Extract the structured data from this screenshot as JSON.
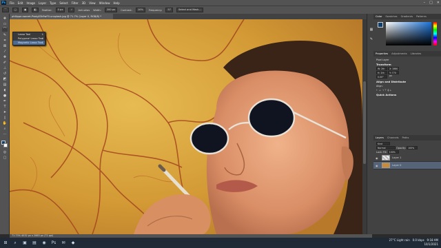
{
  "menubar": {
    "logo": "Ps",
    "items": [
      "File",
      "Edit",
      "Image",
      "Layer",
      "Type",
      "Select",
      "Filter",
      "3D",
      "View",
      "Window",
      "Help"
    ]
  },
  "window_controls": [
    "–",
    "□",
    "✕"
  ],
  "options": {
    "feather_label": "Feather:",
    "feather_value": "0 px",
    "antialias_label": "Anti-alias",
    "width_label": "Width:",
    "width_value": "200 px",
    "contrast_label": "Contrast:",
    "contrast_value": "10%",
    "frequency_label": "Frequency:",
    "frequency_value": "57",
    "select_mask": "Select and Mask..."
  },
  "doc_tab": "philippe-sworet-Pwdg03k9wF0-unsplash.jpg @ 71.7% (Layer 0, RGB/8) *",
  "flyout": {
    "items": [
      {
        "label": "Lasso Tool",
        "key": "L"
      },
      {
        "label": "Polygonal Lasso Tool",
        "key": "L"
      },
      {
        "label": "Magnetic Lasso Tool",
        "key": "L"
      }
    ]
  },
  "status": "71.73%   4032 px x 2883 px (72 ppi)",
  "color_panel": {
    "tabs": [
      "Color",
      "Swatches",
      "Gradients",
      "Patterns"
    ]
  },
  "props_panel": {
    "tabs": [
      "Properties",
      "Adjustments",
      "Libraries"
    ],
    "layer_kind": "Pixel Layer",
    "transform": "Transform",
    "w": "W: 2th px",
    "h": "H: 2th px",
    "x": "X: 2880 px",
    "y": "Y: 770 px",
    "angle": "0.00°",
    "align": "Align and Distribute",
    "align_sub": "Align:",
    "quick": "Quick Actions"
  },
  "layers_panel": {
    "tabs": [
      "Layers",
      "Channels",
      "Paths"
    ],
    "kind": "Kind",
    "blend": "Normal",
    "opacity_label": "Opacity:",
    "opacity": "100%",
    "lock_label": "Lock:",
    "fill_label": "Fill:",
    "fill": "100%",
    "layers": [
      "Layer 1",
      "Layer 0"
    ]
  },
  "taskbar": {
    "weather": "27°C Light rain",
    "time": "9:18 AM",
    "date": "10/1/2021",
    "net": "0.0 kbps"
  },
  "colors": {
    "accent": "#31a8ff",
    "canvas_yellow": "#d9a43a"
  }
}
